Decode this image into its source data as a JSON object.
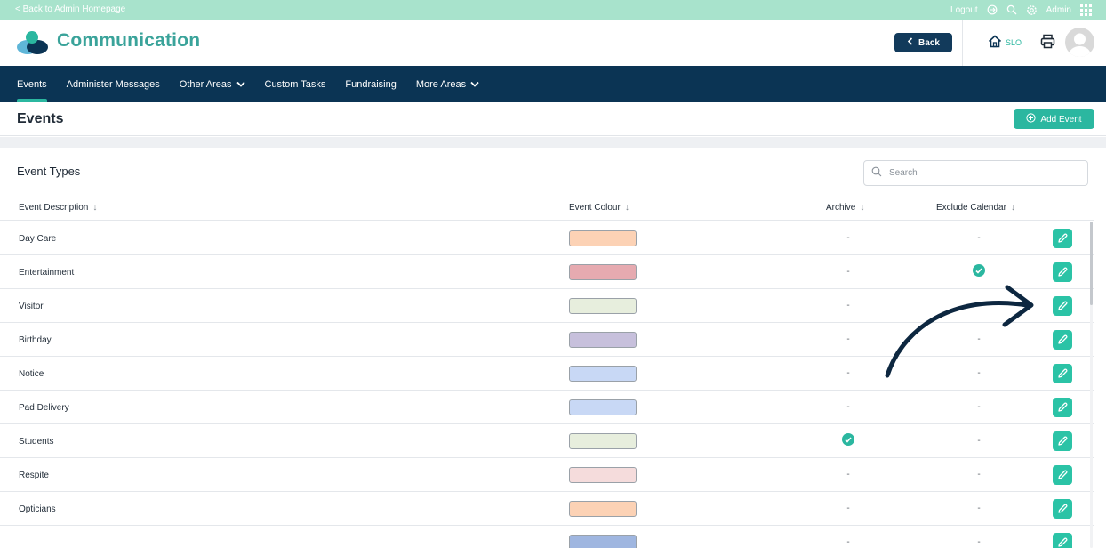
{
  "topbar": {
    "back_link": "< Back to Admin Homepage",
    "logout": "Logout",
    "admin": "Admin"
  },
  "header": {
    "title": "Communication",
    "back_button": "Back",
    "home_label": "SLO"
  },
  "nav": {
    "items": [
      {
        "label": "Events",
        "active": true,
        "dropdown": false
      },
      {
        "label": "Administer Messages",
        "active": false,
        "dropdown": false
      },
      {
        "label": "Other Areas",
        "active": false,
        "dropdown": true
      },
      {
        "label": "Custom Tasks",
        "active": false,
        "dropdown": false
      },
      {
        "label": "Fundraising",
        "active": false,
        "dropdown": false
      },
      {
        "label": "More Areas",
        "active": false,
        "dropdown": true
      }
    ]
  },
  "page": {
    "title": "Events",
    "add_button": "Add Event"
  },
  "card": {
    "title": "Event Types",
    "search_placeholder": "Search"
  },
  "table": {
    "columns": [
      "Event Description",
      "Event Colour",
      "Archive",
      "Exclude Calendar"
    ],
    "rows": [
      {
        "description": "Day Care",
        "colour": "#fcd2b5",
        "archive": false,
        "exclude_calendar": false
      },
      {
        "description": "Entertainment",
        "colour": "#e6aab0",
        "archive": false,
        "exclude_calendar": true
      },
      {
        "description": "Visitor",
        "colour": "#e7eedd",
        "archive": false,
        "exclude_calendar": false
      },
      {
        "description": "Birthday",
        "colour": "#c7c0dc",
        "archive": false,
        "exclude_calendar": false
      },
      {
        "description": "Notice",
        "colour": "#c8d8f5",
        "archive": false,
        "exclude_calendar": false
      },
      {
        "description": "Pad Delivery",
        "colour": "#c8d8f5",
        "archive": false,
        "exclude_calendar": false
      },
      {
        "description": "Students",
        "colour": "#e7eedd",
        "archive": true,
        "exclude_calendar": false
      },
      {
        "description": "Respite",
        "colour": "#f5dcdc",
        "archive": false,
        "exclude_calendar": false
      },
      {
        "description": "Opticians",
        "colour": "#fcd2b5",
        "archive": false,
        "exclude_calendar": false
      },
      {
        "description": "",
        "colour": "#9fb6e0",
        "archive": false,
        "exclude_calendar": false
      }
    ],
    "dash": "-"
  },
  "colors": {
    "brand_teal": "#2bb7a0",
    "nav_navy": "#0b3454",
    "top_strip": "#a8e3cc",
    "title_teal": "#3aa39a"
  },
  "icons": {
    "logo": "communication-logo",
    "back": "chevron-left-icon",
    "home": "home-icon",
    "print": "printer-icon",
    "avatar": "user-avatar",
    "add": "plus-circle-icon",
    "search": "search-icon",
    "sort": "arrow-down-icon",
    "edit": "pencil-icon",
    "check": "check-circle-icon",
    "annotation": "curved-arrow-annotation"
  }
}
